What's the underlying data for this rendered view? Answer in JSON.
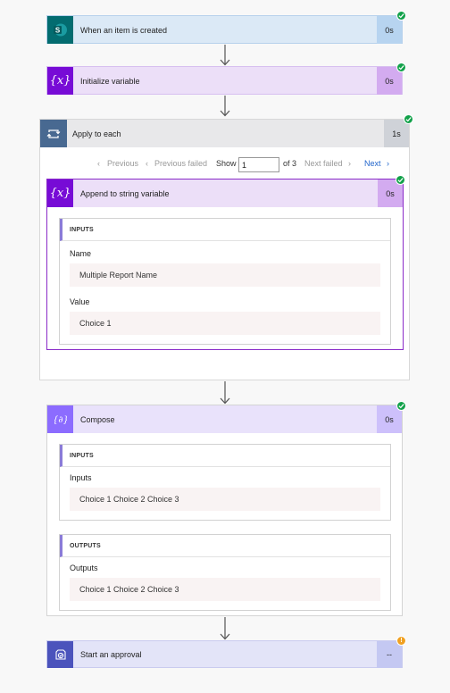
{
  "steps": {
    "trigger": {
      "title": "When an item is created",
      "duration": "0s",
      "icon": "sharepoint-icon",
      "status": "succeeded"
    },
    "init_var": {
      "title": "Initialize variable",
      "duration": "0s",
      "icon": "variable-icon",
      "status": "succeeded"
    },
    "apply_each": {
      "title": "Apply to each",
      "duration": "1s",
      "icon": "loop-icon",
      "status": "succeeded",
      "pager": {
        "previous": "Previous",
        "previous_failed": "Previous failed",
        "show_label": "Show",
        "current": "1",
        "of_total": "of 3",
        "next_failed": "Next failed",
        "next": "Next"
      },
      "inner": {
        "title": "Append to string variable",
        "duration": "0s",
        "icon": "variable-icon",
        "status": "succeeded",
        "inputs_label": "INPUTS",
        "name_label": "Name",
        "name_value": "Multiple Report Name",
        "value_label": "Value",
        "value_value": "Choice 1"
      }
    },
    "compose": {
      "title": "Compose",
      "duration": "0s",
      "icon": "compose-icon",
      "status": "succeeded",
      "inputs_label": "INPUTS",
      "inputs_field_label": "Inputs",
      "inputs_value": "Choice 1 Choice 2 Choice 3",
      "outputs_label": "OUTPUTS",
      "outputs_field_label": "Outputs",
      "outputs_value": "Choice 1 Choice 2 Choice 3"
    },
    "approval": {
      "title": "Start an approval",
      "duration": "--",
      "icon": "approval-icon",
      "status": "warning"
    }
  },
  "colors": {
    "sharepoint": "#036c70",
    "variable": "#770bd6",
    "loop": "#486991",
    "compose": "#8c6cff",
    "approval": "#4b53bc",
    "success": "#12a14a",
    "warning": "#f0a020",
    "link": "#2266cc"
  }
}
